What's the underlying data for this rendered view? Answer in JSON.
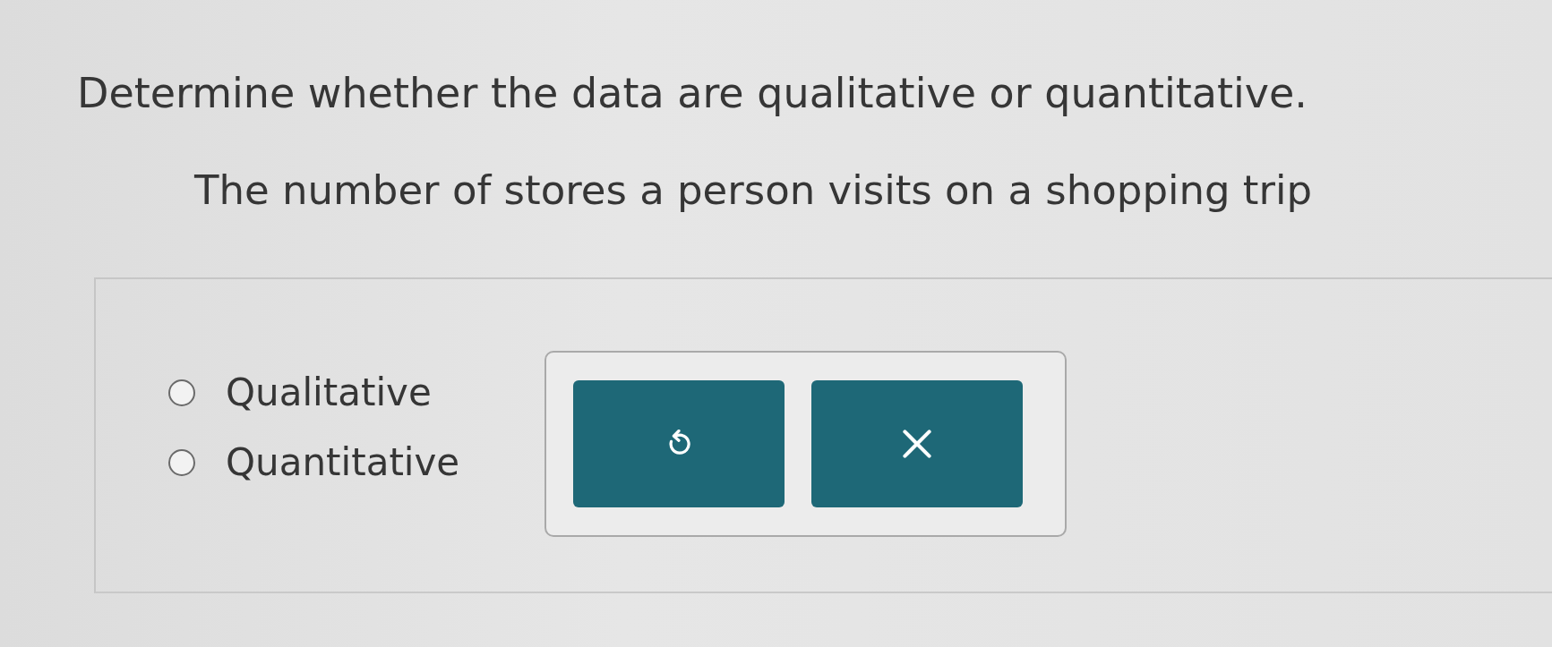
{
  "question": {
    "instruction": "Determine whether the data are qualitative or quantitative.",
    "prompt": "The number of stores a person visits on a shopping trip"
  },
  "options": [
    {
      "label": "Qualitative",
      "selected": false
    },
    {
      "label": "Quantitative",
      "selected": false
    }
  ],
  "buttons": [
    {
      "kind": "undo"
    },
    {
      "kind": "clear"
    }
  ]
}
